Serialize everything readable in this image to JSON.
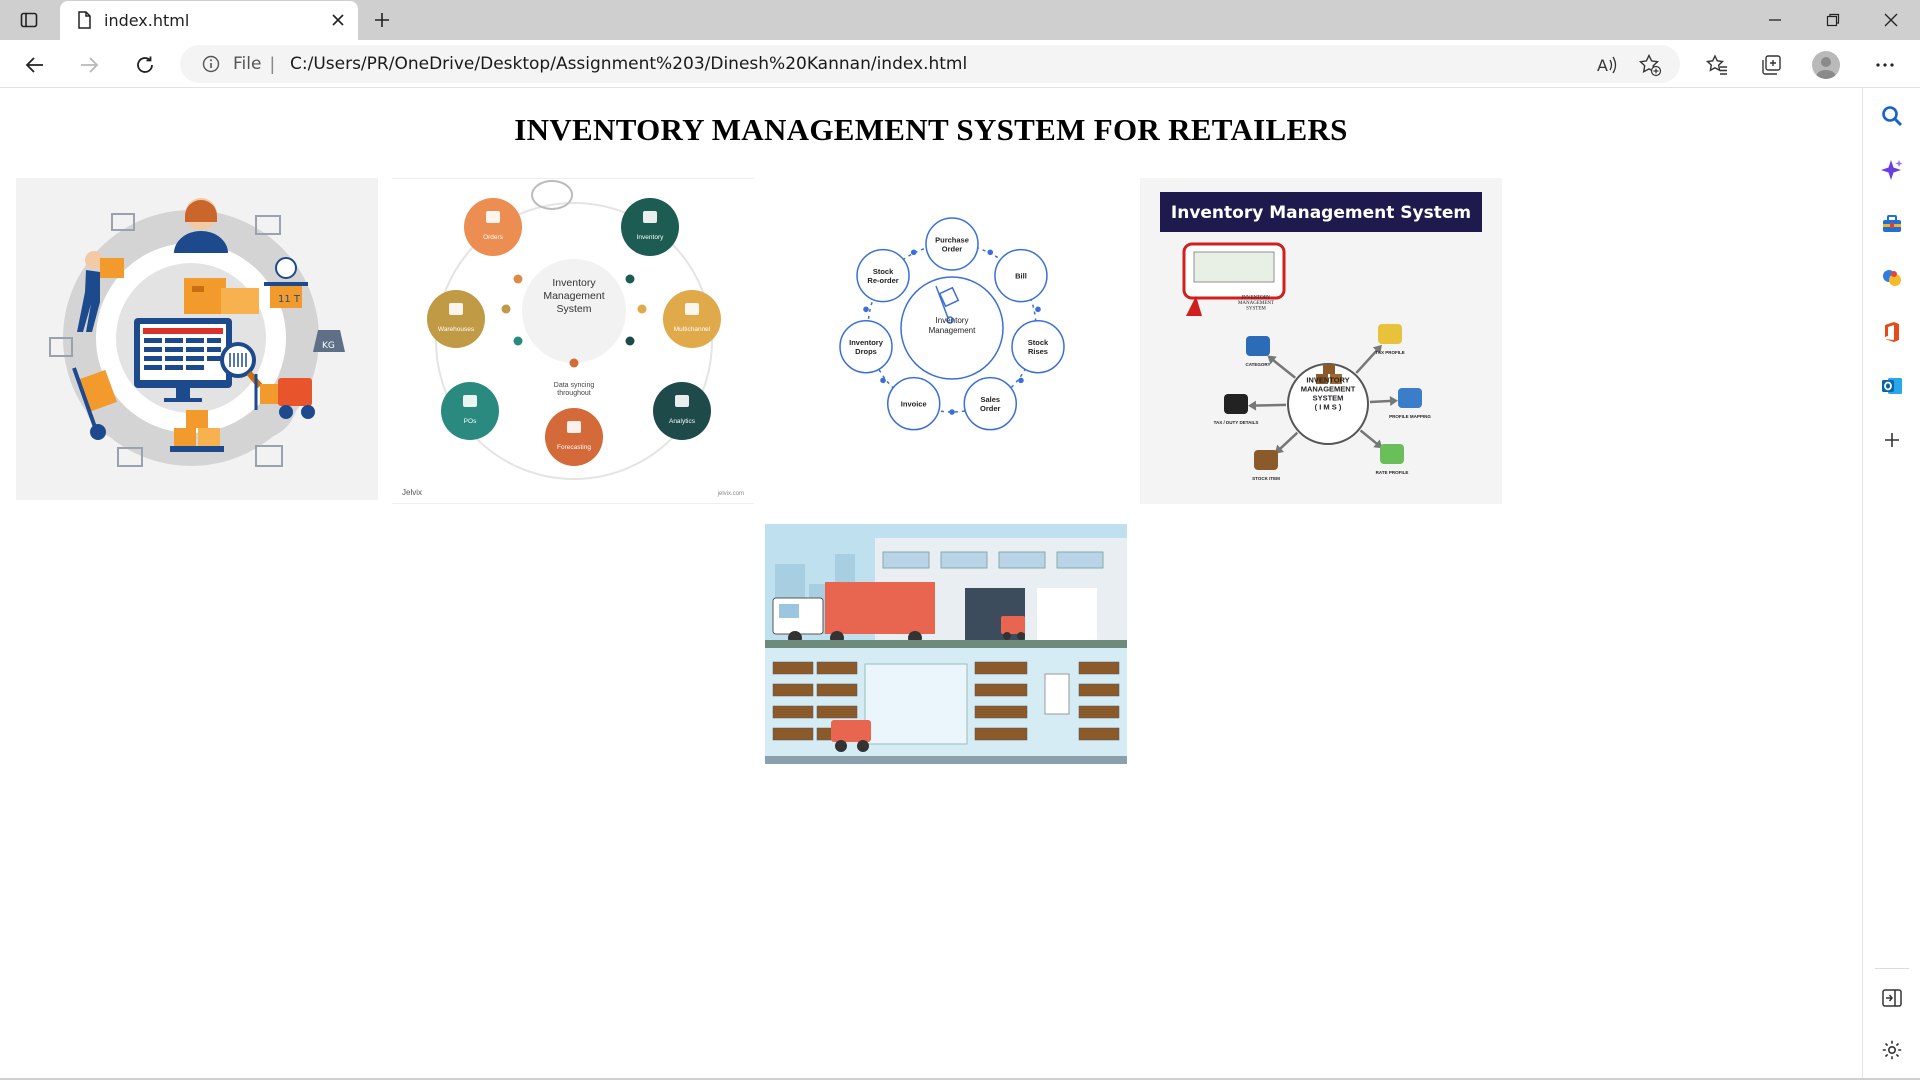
{
  "browser": {
    "tab_title": "index.html",
    "address_file_label": "File",
    "address_url": "C:/Users/PR/OneDrive/Desktop/Assignment%203/Dinesh%20Kannan/index.html",
    "icons": {
      "sidebar_toggle": "sidebar-toggle-icon",
      "tab_page": "page-icon",
      "tab_close": "close-icon",
      "new_tab": "plus-icon",
      "minimize": "minimize-icon",
      "restore": "restore-icon",
      "close_window": "close-icon",
      "back": "arrow-left-icon",
      "forward": "arrow-right-icon",
      "refresh": "refresh-icon",
      "info": "info-icon",
      "read_aloud": "read-aloud-icon",
      "add_favorite": "star-plus-icon",
      "favorites": "favorites-icon",
      "collections": "collections-icon",
      "profile": "avatar",
      "menu": "ellipsis-icon"
    }
  },
  "edge_sidebar": {
    "items": [
      "search-icon",
      "copilot-icon",
      "tools-icon",
      "games-icon",
      "office-icon",
      "outlook-icon",
      "add-icon",
      "sidebar-panel-icon",
      "settings-icon"
    ]
  },
  "page": {
    "title": "INVENTORY MANAGEMENT SYSTEM FOR RETAILERS",
    "image2": {
      "center_label": "Inventory\nManagement\nSystem",
      "nodes": [
        "Orders",
        "Inventory",
        "Multichannel",
        "Analytics",
        "Forecasting",
        "POs",
        "Warehouses"
      ],
      "sync_label": "Data syncing\nthroughout",
      "brand_left": "Jelvix",
      "brand_right": "jelvix.com"
    },
    "image3": {
      "center_label": "Inventory\nManagement",
      "nodes": [
        "Purchase\nOrder",
        "Bill",
        "Stock\nRises",
        "Sales\nOrder",
        "Invoice",
        "Inventory\nDrops",
        "Stock\nRe-order"
      ]
    },
    "image4": {
      "banner": "Inventory Management System",
      "center_label": "INVENTORY\nMANAGEMENT\nSYSTEM\n( I M S )",
      "nodes": [
        "CATEGORY",
        "TAX PROFILE",
        "PROFILE MAPPING",
        "RATE PROFILE",
        "STOCK ITEM",
        "TAX / DUTY DETAILS"
      ],
      "inset_caption": "INVENTORY\nMANAGEMENT\nSYSTEM"
    },
    "image1": {
      "shelf_tag": "11 T"
    }
  },
  "colors": {
    "tabstrip": "#cfcfcf",
    "banner_navy": "#1e1a4d",
    "orange": "#f39a2c",
    "teal": "#1f7a72",
    "blue_line": "#3a6fd8"
  }
}
